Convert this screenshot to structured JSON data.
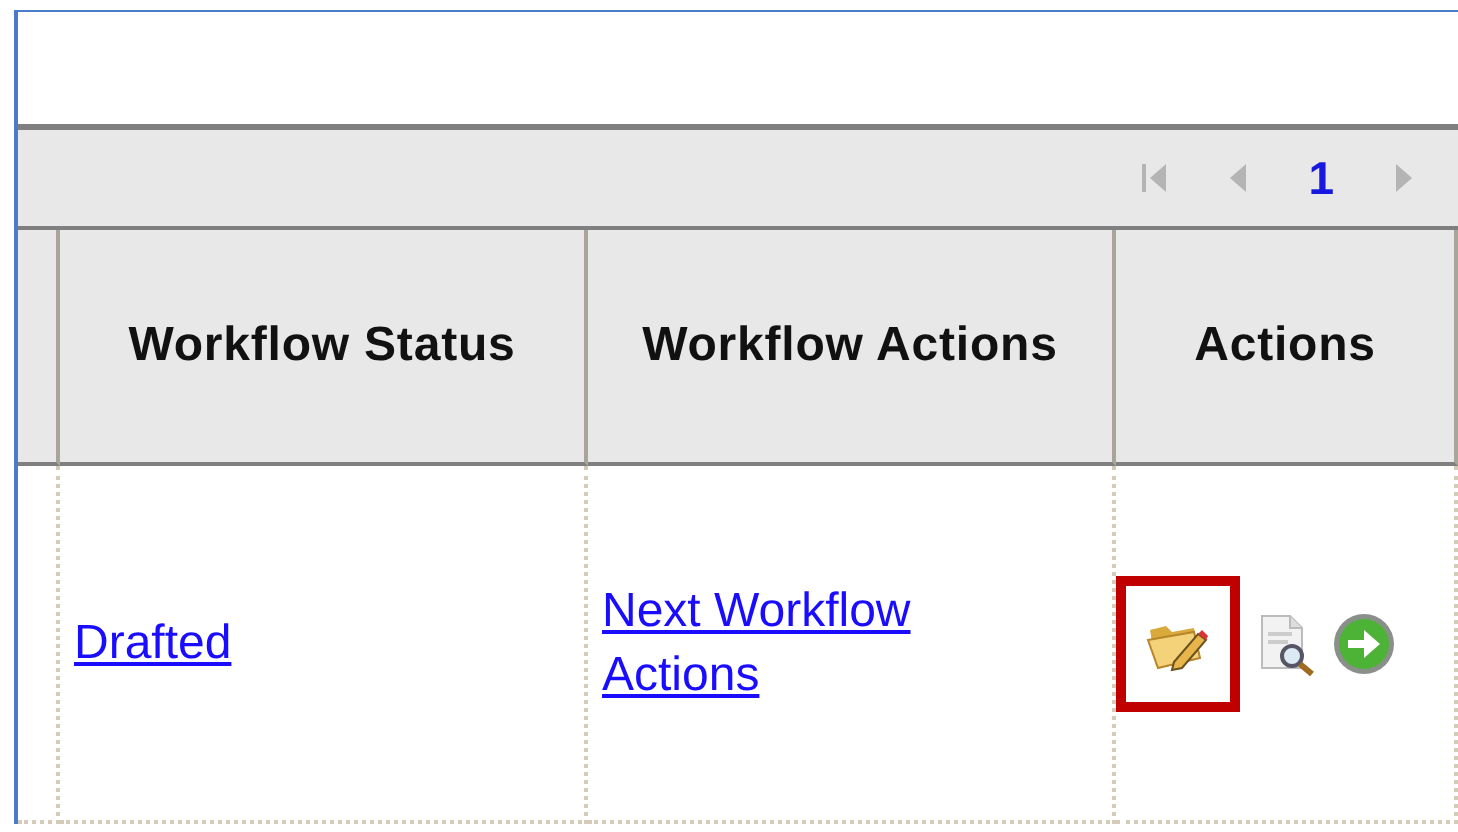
{
  "pager": {
    "items": [
      {
        "kind": "first",
        "disabled": true
      },
      {
        "kind": "prev",
        "disabled": true
      },
      {
        "kind": "page",
        "label": "1",
        "selected": true
      },
      {
        "kind": "next",
        "disabled": true
      }
    ]
  },
  "table": {
    "columns": [
      {
        "label": "Workflow Status"
      },
      {
        "label": "Workflow Actions"
      },
      {
        "label": "Actions"
      }
    ],
    "rows": [
      {
        "status": "Drafted",
        "workflow_actions": "Next Workflow Actions",
        "actions": [
          {
            "kind": "edit",
            "highlighted": true
          },
          {
            "kind": "preview",
            "highlighted": false
          },
          {
            "kind": "go",
            "highlighted": false
          }
        ]
      }
    ]
  }
}
